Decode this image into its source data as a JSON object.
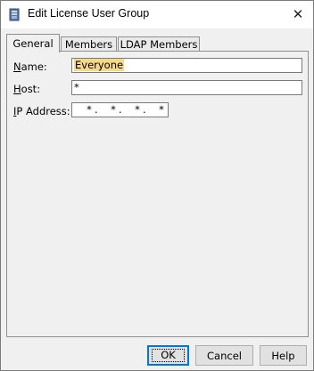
{
  "window": {
    "title": "Edit License User Group",
    "close_glyph": "✕",
    "app_icon": "license-server-icon"
  },
  "tabs": [
    {
      "label": "General",
      "active": true
    },
    {
      "label": "Members",
      "active": false
    },
    {
      "label": "LDAP Members",
      "active": false
    }
  ],
  "form": {
    "name": {
      "label_mnemonic": "N",
      "label_rest": "ame:",
      "value": "Everyone"
    },
    "host": {
      "label_mnemonic": "H",
      "label_rest": "ost:",
      "value": "*"
    },
    "ip": {
      "label_mnemonic": "I",
      "label_rest": "P Address:",
      "octets": [
        "*",
        "*",
        "*",
        "*"
      ],
      "separator": "."
    }
  },
  "buttons": {
    "ok": "OK",
    "cancel": "Cancel",
    "help": "Help"
  }
}
